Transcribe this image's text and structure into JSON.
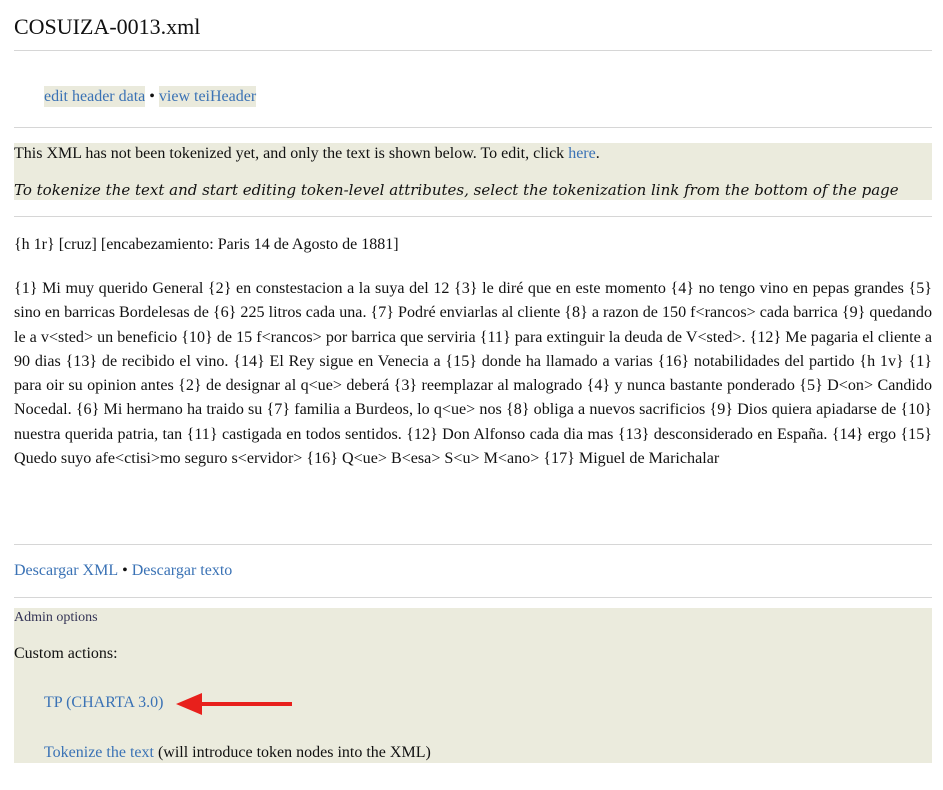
{
  "page": {
    "title": "COSUIZA-0013.xml"
  },
  "header_links": {
    "edit": "edit header data",
    "separator": "•",
    "view": "view teiHeader"
  },
  "notice": {
    "text": "This XML has not been tokenized yet, and only the text is shown below. To edit, click",
    "link": "here",
    "period": ".",
    "tokenize_hint": "To tokenize the text and start editing token-level attributes, select the tokenization link from the bottom of the page"
  },
  "document": {
    "header_line": "{h 1r} [cruz] [encabezamiento: Paris 14 de Agosto de 1881]",
    "body": "{1} Mi muy querido General {2} en constestacion a la suya del 12 {3} le diré que en este momento {4} no tengo vino en pepas grandes {5} sino en barricas Bordelesas de {6} 225 litros cada una. {7} Podré enviarlas al cliente {8} a razon de 150 f<rancos> cada barrica {9} quedando le a v<sted> un beneficio {10} de 15 f<rancos> por barrica que serviria {11} para extinguir la deuda de V<sted>. {12} Me pagaria el cliente a 90 dias {13} de recibido el vino. {14} El Rey sigue en Venecia a {15} donde ha llamado a varias {16} notabilidades del partido {h 1v} {1} para oir su opinion antes {2} de designar al q<ue> deberá {3} reemplazar al malogrado {4} y nunca bastante ponderado {5} D<on> Candido Nocedal. {6} Mi hermano ha traido su {7} familia a Burdeos, lo q<ue> nos {8} obliga a nuevos sacrificios {9} Dios quiera apiadarse de {10} nuestra querida patria, tan {11} castigada en todos sentidos. {12} Don Alfonso cada dia mas {13} desconsiderado en España. {14} ergo {15} Quedo suyo afe<ctisi>mo seguro s<ervidor>  {16} Q<ue> B<esa> S<u> M<ano> {17} Miguel de Marichalar"
  },
  "downloads": {
    "xml": "Descargar XML",
    "separator": "•",
    "text": "Descargar texto"
  },
  "admin": {
    "title": "Admin options",
    "custom_actions": "Custom actions:",
    "tp_link": "TP (CHARTA 3.0)",
    "tokenize_link": "Tokenize the text",
    "tokenize_note": "(will introduce token nodes into the XML)"
  },
  "colors": {
    "link": "#3a72b5",
    "panel_bg": "#ebebdd",
    "arrow": "#e8201c"
  },
  "icons": {
    "annotation": "red-arrow-left-icon"
  }
}
